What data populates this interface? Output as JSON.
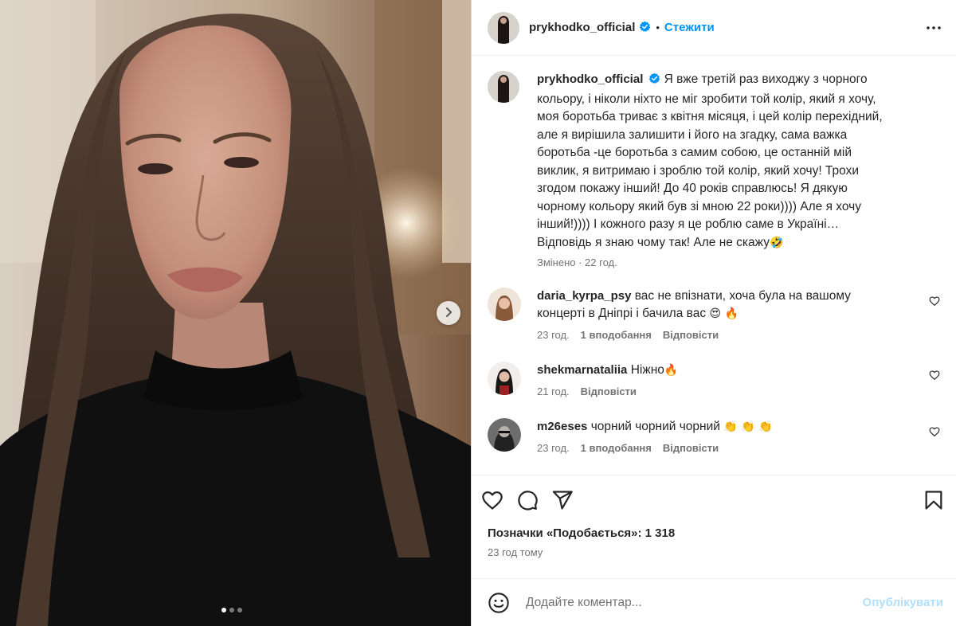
{
  "header": {
    "username": "prykhodko_official",
    "separator": "•",
    "follow_label": "Стежити"
  },
  "caption": {
    "username": "prykhodko_official",
    "text": "Я вже третій раз виходжу з чорного кольору, і ніколи ніхто не міг зробити той колір, який я хочу, моя боротьба триває з квітня місяця, і цей колір перехідний, але я вирішила залишити і його на згадку, сама важка боротьба -це боротьба з самим собою, це останній мій виклик, я витримаю і зроблю той колір, який хочу! Трохи згодом покажу інший! До 40 років справлюсь! Я дякую чорному кольору який був зі мною 22 роки)))) Але я хочу інший!)))) І кожного разу я це роблю саме в Україні… Відповідь я знаю чому так! Але не скажу",
    "emoji": "🤣",
    "meta": "Змінено · 22 год."
  },
  "comments": [
    {
      "username": "daria_kyrpa_psy",
      "text": "вас не впізнати, хоча була на вашому концерті в Дніпрі і бачила вас",
      "emoji": "😍 🔥",
      "time": "23 год.",
      "likes": "1 вподобання",
      "reply": "Відповісти"
    },
    {
      "username": "shekmarnataliia",
      "text": "Ніжно",
      "emoji": "🔥",
      "time": "21 год.",
      "likes": "",
      "reply": "Відповісти"
    },
    {
      "username": "m26eses",
      "text": "чорний чорний чорний",
      "emoji": "👏 👏 👏",
      "time": "23 год.",
      "likes": "1 вподобання",
      "reply": "Відповісти"
    }
  ],
  "likes": {
    "label": "Позначки «Подобається»: 1 318"
  },
  "timestamp": "23 год тому",
  "add_comment": {
    "placeholder": "Додайте коментар...",
    "publish_label": "Опублікувати"
  },
  "carousel": {
    "total": 3,
    "active": 1
  },
  "colors": {
    "accent": "#0095f6",
    "publish_disabled": "#b2dffc",
    "muted": "#737373",
    "text": "#262626"
  },
  "icons": [
    "verified-badge-icon",
    "more-options-icon",
    "heart-icon",
    "comment-icon",
    "share-icon",
    "bookmark-icon",
    "emoji-icon",
    "chevron-right-icon"
  ]
}
